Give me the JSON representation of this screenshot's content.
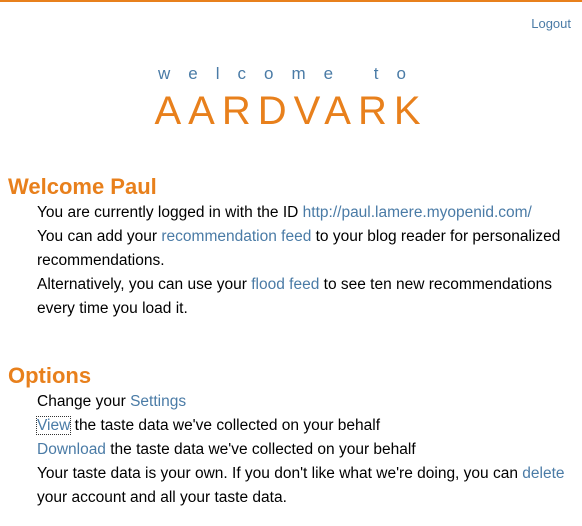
{
  "header": {
    "logout_label": "Logout"
  },
  "brand": {
    "welcome_to": "welcome to",
    "name": "AARDVARK"
  },
  "welcome": {
    "heading": "Welcome Paul",
    "line1_prefix": "You are currently logged in with the ID ",
    "openid_link": "http://paul.lamere.myopenid.com/",
    "line2_prefix": "You can add your ",
    "recommendation_feed_link": "recommendation feed",
    "line2_suffix": " to your blog reader for personalized recommendations.",
    "line3_prefix": "Alternatively, you can use your ",
    "flood_feed_link": "flood feed",
    "line3_suffix": " to see ten new recommendations every time you load it."
  },
  "options": {
    "heading": "Options",
    "settings_prefix": "Change your ",
    "settings_link": "Settings",
    "view_link": "View",
    "view_suffix": " the taste data we've collected on your behalf",
    "download_link": "Download",
    "download_suffix": " the taste data we've collected on your behalf",
    "own_text": "Your taste data is your own. If you don't like what we're doing, you can ",
    "delete_link": "delete",
    "delete_suffix": " your account and all your taste data."
  }
}
